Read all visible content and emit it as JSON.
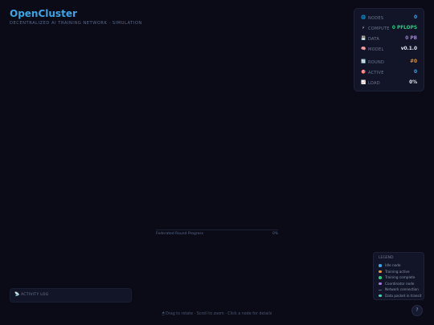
{
  "header": {
    "title": "OpenCluster",
    "subtitle": "DECENTRALIZED AI TRAINING NETWORK · SIMULATION"
  },
  "stats": [
    {
      "icon": "globe-icon",
      "glyph": "🌐",
      "label": "NODES",
      "value": "0",
      "color": "#3aa6e8"
    },
    {
      "icon": "lightning-icon",
      "glyph": "⚡",
      "label": "COMPUTE",
      "value": "0 PFLOPS",
      "color": "#22d17a"
    },
    {
      "icon": "disk-icon",
      "glyph": "💾",
      "label": "DATA",
      "value": "0 PB",
      "color": "#a77be8"
    },
    {
      "icon": "brain-icon",
      "glyph": "🧠",
      "label": "MODEL",
      "value": "v0.1.0",
      "color": "#e6ebf5"
    },
    {
      "icon": "refresh-icon",
      "glyph": "🔄",
      "label": "ROUND",
      "value": "#0",
      "color": "#f0962e"
    },
    {
      "icon": "target-icon",
      "glyph": "🎯",
      "label": "ACTIVE",
      "value": "0",
      "color": "#3aa6e8"
    },
    {
      "icon": "chart-icon",
      "glyph": "📈",
      "label": "LOAD",
      "value": "0%",
      "color": "#e6ebf5"
    }
  ],
  "progress": {
    "label": "Federated Round Progress",
    "percent_text": "0%",
    "value": 0
  },
  "legend": {
    "title": "LEGEND",
    "items": [
      {
        "label": "Idle node",
        "color": "#3aa6e8",
        "kind": "dot"
      },
      {
        "label": "Training active",
        "color": "#f0962e",
        "kind": "dot"
      },
      {
        "label": "Training complete",
        "color": "#22d17a",
        "kind": "dot"
      },
      {
        "label": "Coordinator node",
        "color": "#a77be8",
        "kind": "dot"
      },
      {
        "label": "Network connection",
        "color": "#56607a",
        "kind": "line"
      },
      {
        "label": "Data packet in transit",
        "color": "#2fd6c0",
        "kind": "dot"
      }
    ]
  },
  "activity": {
    "glyph": "📡",
    "label": "ACTIVITY LOG"
  },
  "hint": "🖱 Drag to rotate · Scroll to zoom · Click a node for details",
  "help": {
    "label": "?"
  }
}
